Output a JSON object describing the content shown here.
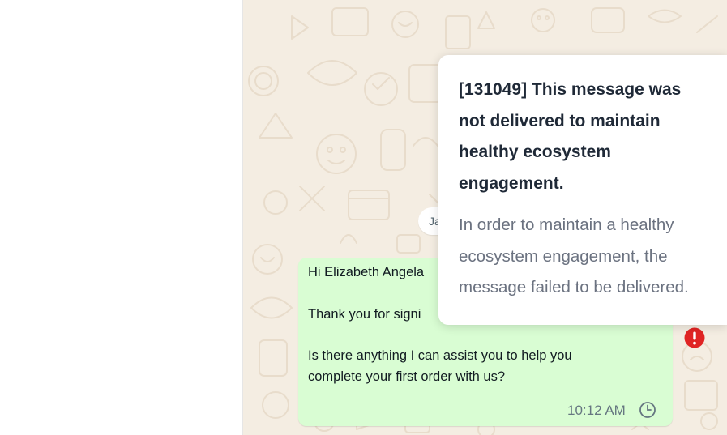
{
  "colors": {
    "chat_background": "#f4ede2",
    "outgoing_bubble": "#d9fdd3",
    "error_red": "#e02424",
    "tooltip_title": "#1f2937",
    "tooltip_body": "#6b7280"
  },
  "chat": {
    "date_separator": "Ja",
    "message": {
      "lines": [
        "Hi Elizabeth Angela",
        "Thank you for signi",
        "Is there anything I can assist you to help you",
        "complete your first order with us?"
      ],
      "time": "10:12 AM",
      "status_icon": "clock-icon",
      "error_icon": "error-exclamation-icon"
    }
  },
  "tooltip": {
    "error_code": "[131049]",
    "title": "This message was not delivered to maintain healthy ecosystem engagement.",
    "body": "In order to maintain a healthy ecosystem engagement, the message failed to be delivered."
  }
}
